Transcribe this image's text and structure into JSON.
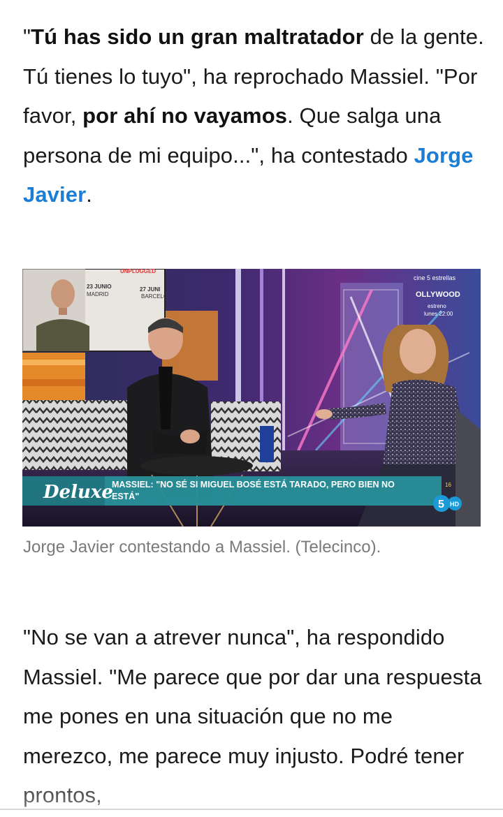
{
  "article": {
    "paragraph1": {
      "q_open": "\"",
      "bold1": "Tú has sido un gran maltratador",
      "text1": " de la gente. Tú tienes lo tuyo\", ha reprochado Massiel. \"Por favor, ",
      "bold2": "por ahí no vayamos",
      "text2": ". Que salga una persona de mi equipo...\", ha contestado ",
      "link": "Jorge Javier",
      "text3": "."
    },
    "image": {
      "caption": "Jorge Javier contestando a Massiel. (Telecinco).",
      "overlay": {
        "show_logo": "Deluxe",
        "ticker": "MASSIEL: \"NO SÉ SI MIGUEL BOSÉ ESTÁ TARADO, PERO BIEN NO ESTÁ\"",
        "channel": "5",
        "hd": "HD",
        "age_rating": "16",
        "promo_line1": "cine 5 estrellas",
        "promo_line2": "OLLYWOOD",
        "promo_line3": "estreno",
        "promo_line4": "lunes 22:00",
        "screen_unplugged": "UNPLUGGED",
        "screen_date1": "23 JUNIO",
        "screen_city1": "MADRID",
        "screen_date2": "27 JUNI",
        "screen_city2": "BARCELO"
      }
    },
    "paragraph2": "\"No se van a atrever nunca\", ha respondido Massiel. \"Me parece que por dar una respuesta me pones en una situación que no me merezco, me parece muy injusto. Podré tener prontos,"
  },
  "colors": {
    "link": "#1a7ed6",
    "caption": "#7a7a7a",
    "ticker_bg": "#1f7d86"
  }
}
